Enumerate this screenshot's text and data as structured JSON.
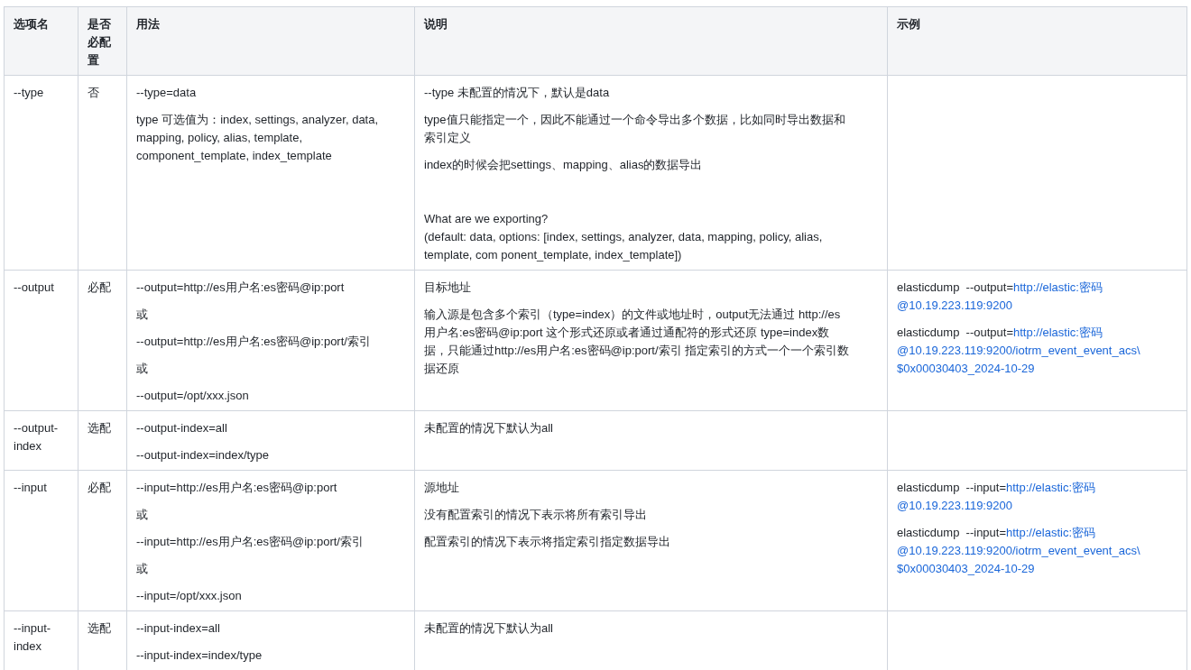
{
  "table": {
    "columns": [
      "选项名",
      "是否必配置",
      "用法",
      "说明",
      "示例"
    ],
    "rows": [
      {
        "option": "--type",
        "required": "否",
        "usage": [
          "--type=data",
          "type 可选值为：index, settings, analyzer, data, mapping, policy, alias, template, component_template, index_template"
        ],
        "description": [
          {
            "text": "--type 未配置的情况下，默认是data"
          },
          {
            "text": "type值只能指定一个，因此不能通过一个命令导出多个数据，比如同时导出数据和索引定义"
          },
          {
            "text": "index的时候会把settings、mapping、alias的数据导出"
          },
          {
            "text": "What are we exporting?\n(default: data, options: [index, settings, analyzer, data, mapping, policy, alias, template, com ponent_template, index_template])",
            "gap_before": true
          }
        ]
      },
      {
        "option": "--output",
        "required": "必配",
        "usage": [
          "--output=http://es用户名:es密码@ip:port",
          "或",
          "--output=http://es用户名:es密码@ip:port/索引",
          "或",
          "--output=/opt/xxx.json"
        ],
        "description": [
          {
            "text": "目标地址"
          },
          {
            "text": "输入源是包含多个索引（type=index）的文件或地址时，output无法通过 http://es用户名:es密码@ip:port 这个形式还原或者通过通配符的形式还原 type=index数据，只能通过http://es用户名:es密码@ip:port/索引 指定索引的方式一个一个索引数据还原"
          }
        ],
        "examples": [
          {
            "command": "elasticdump  --output=",
            "link_lines": [
              "http://elastic:密码",
              "@10.19.223.119:9200"
            ]
          },
          {
            "command": "elasticdump  --output=",
            "link_lines": [
              "http://elastic:密码",
              "@10.19.223.119:9200/iotrm_event_event_acs\\",
              "$0x00030403_2024-10-29"
            ]
          }
        ]
      },
      {
        "option": "--output-index",
        "required": "选配",
        "usage": [
          "--output-index=all",
          "--output-index=index/type"
        ],
        "description": [
          {
            "text": "未配置的情况下默认为all"
          }
        ]
      },
      {
        "option": "--input",
        "required": "必配",
        "usage": [
          "--input=http://es用户名:es密码@ip:port",
          "或",
          "--input=http://es用户名:es密码@ip:port/索引",
          "或",
          "--input=/opt/xxx.json"
        ],
        "description": [
          {
            "text": "源地址"
          },
          {
            "text": "没有配置索引的情况下表示将所有索引导出"
          },
          {
            "text": "配置索引的情况下表示将指定索引指定数据导出"
          }
        ],
        "examples": [
          {
            "command": "elasticdump  --input=",
            "link_lines": [
              "http://elastic:密码",
              "@10.19.223.119:9200"
            ]
          },
          {
            "command": "elasticdump  --input=",
            "link_lines": [
              "http://elastic:密码",
              "@10.19.223.119:9200/iotrm_event_event_acs\\",
              "$0x00030403_2024-10-29"
            ]
          }
        ]
      },
      {
        "option": "--input-index",
        "required": "选配",
        "usage": [
          "--input-index=all",
          "--input-index=index/type"
        ],
        "description": [
          {
            "text": "未配置的情况下默认为all"
          }
        ]
      }
    ]
  }
}
